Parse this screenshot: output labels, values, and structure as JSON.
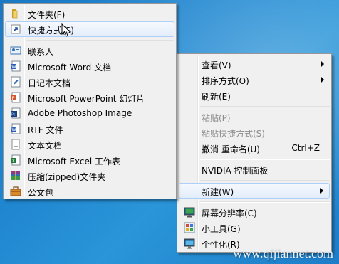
{
  "new_submenu": {
    "items": [
      {
        "label": "文件夹(F)"
      },
      {
        "label": "快捷方式(S)"
      },
      {
        "label": "联系人"
      },
      {
        "label": "Microsoft Word 文档"
      },
      {
        "label": "日记本文档"
      },
      {
        "label": "Microsoft PowerPoint 幻灯片"
      },
      {
        "label": "Adobe Photoshop Image"
      },
      {
        "label": "RTF 文件"
      },
      {
        "label": "文本文档"
      },
      {
        "label": "Microsoft Excel 工作表"
      },
      {
        "label": "压缩(zipped)文件夹"
      },
      {
        "label": "公文包"
      }
    ]
  },
  "desktop_menu": {
    "view": "查看(V)",
    "sort": "排序方式(O)",
    "refresh": "刷新(E)",
    "paste": "粘贴(P)",
    "paste_shortcut": "粘贴快捷方式(S)",
    "undo": "撤消 重命名(U)",
    "undo_accel": "Ctrl+Z",
    "nvidia": "NVIDIA 控制面板",
    "new": "新建(W)",
    "resolution": "屏幕分辨率(C)",
    "gadgets": "小工具(G)",
    "personalize": "个性化(R)"
  },
  "watermark": "www.qijiannet.com",
  "colors": {
    "desktop": "#1f86d0",
    "menu_bg": "#f0f0f0",
    "highlight_border": "#aecff7",
    "disabled_text": "#8d8d8d"
  }
}
